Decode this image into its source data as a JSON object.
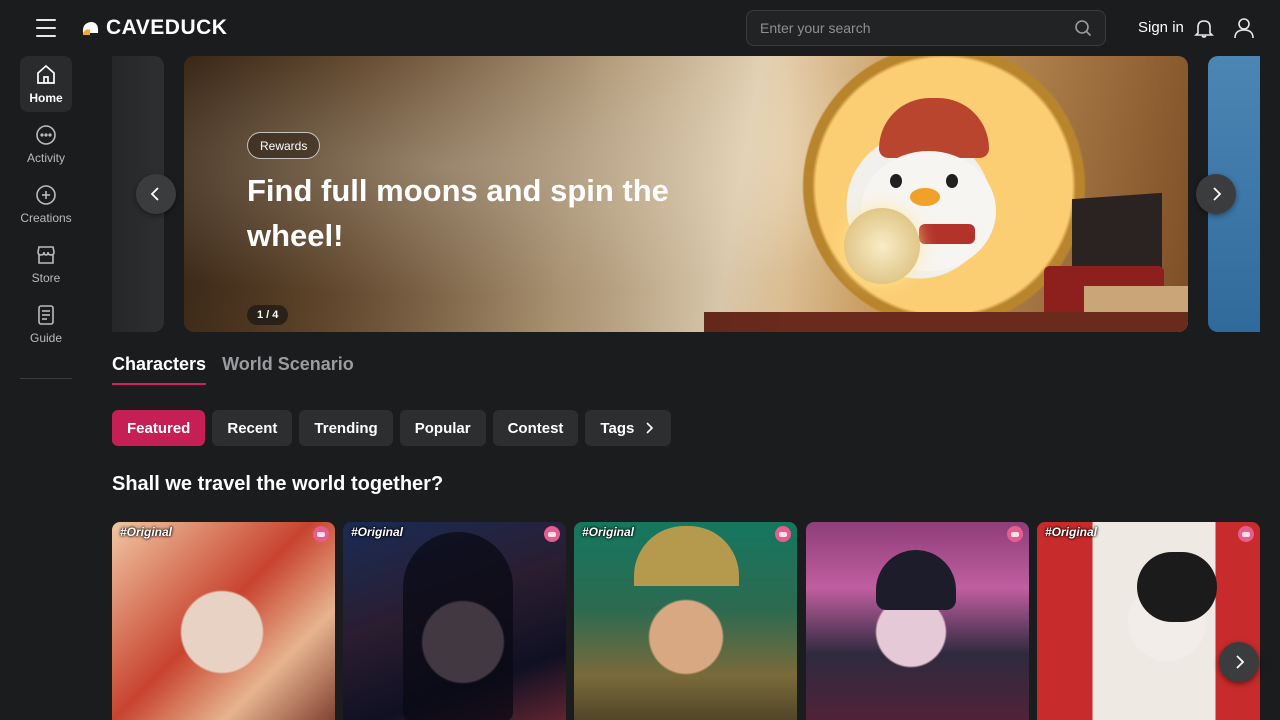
{
  "header": {
    "logo_text": "CAVEDUCK",
    "search_placeholder": "Enter your search",
    "signin_label": "Sign in"
  },
  "sidebar": {
    "items": [
      {
        "label": "Home",
        "icon": "home-icon",
        "active": true
      },
      {
        "label": "Activity",
        "icon": "chat-bubble-icon",
        "active": false
      },
      {
        "label": "Creations",
        "icon": "plus-circle-icon",
        "active": false
      },
      {
        "label": "Store",
        "icon": "store-icon",
        "active": false
      },
      {
        "label": "Guide",
        "icon": "book-icon",
        "active": false
      }
    ]
  },
  "banner": {
    "badge": "Rewards",
    "headline": "Find full moons and spin the wheel!",
    "pager": "1 / 4",
    "current_slide": 1,
    "total_slides": 4
  },
  "tabs": [
    {
      "label": "Characters",
      "active": true
    },
    {
      "label": "World Scenario",
      "active": false
    }
  ],
  "filters": [
    {
      "label": "Featured",
      "active": true
    },
    {
      "label": "Recent",
      "active": false
    },
    {
      "label": "Trending",
      "active": false
    },
    {
      "label": "Popular",
      "active": false
    },
    {
      "label": "Contest",
      "active": false
    },
    {
      "label": "Tags",
      "active": false
    }
  ],
  "section": {
    "title": "Shall we travel the world together?"
  },
  "cards": [
    {
      "tag": "#Original",
      "has_badge": true
    },
    {
      "tag": "#Original",
      "has_badge": true
    },
    {
      "tag": "#Original",
      "has_badge": true
    },
    {
      "tag": "",
      "has_badge": true
    },
    {
      "tag": "#Original",
      "has_badge": true
    }
  ],
  "colors": {
    "accent": "#c51f56",
    "background": "#1b1c1d",
    "chip": "#2d2e30"
  }
}
